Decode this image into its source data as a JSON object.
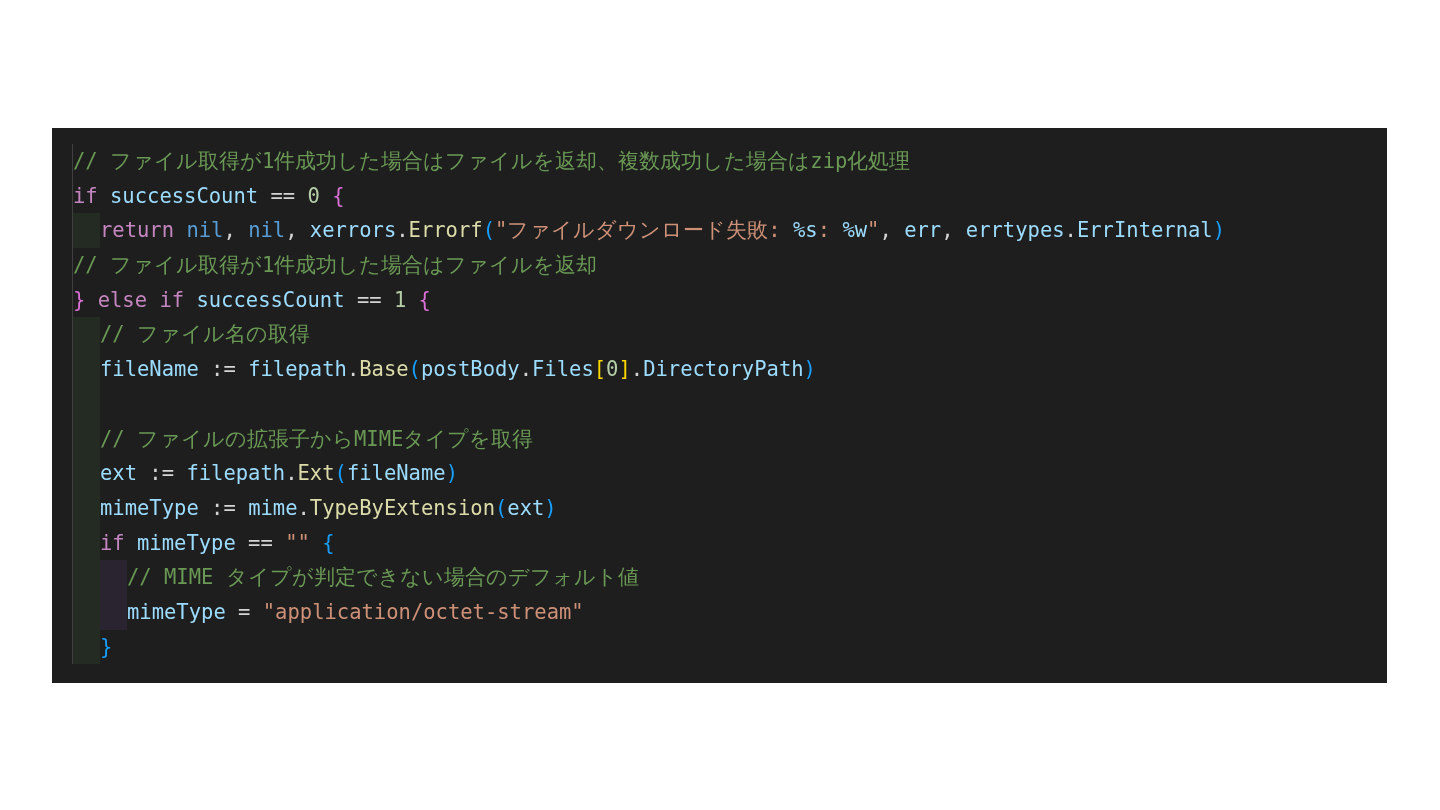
{
  "editor": {
    "lines": [
      {
        "tokens": [
          {
            "text": "// ファイル取得が1件成功した場合はファイルを返却、複数成功した場合はzip化処理",
            "kind": "comment"
          }
        ]
      },
      {
        "tokens": [
          {
            "text": "if ",
            "kind": "keyword"
          },
          {
            "text": "successCount",
            "kind": "variable"
          },
          {
            "text": " == ",
            "kind": "plain"
          },
          {
            "text": "0 ",
            "kind": "number"
          },
          {
            "text": "{",
            "kind": "brace"
          }
        ],
        "children": [
          {
            "tokens": [
              {
                "text": "return ",
                "kind": "keyword"
              },
              {
                "text": "nil",
                "kind": "constant"
              },
              {
                "text": ", ",
                "kind": "plain"
              },
              {
                "text": "nil",
                "kind": "constant"
              },
              {
                "text": ", ",
                "kind": "plain"
              },
              {
                "text": "xerrors",
                "kind": "variable"
              },
              {
                "text": ".",
                "kind": "plain"
              },
              {
                "text": "Errorf",
                "kind": "function"
              },
              {
                "text": "(",
                "kind": "paren"
              },
              {
                "text": "\"ファイルダウンロード失敗: ",
                "kind": "string"
              },
              {
                "text": "%s",
                "kind": "variable"
              },
              {
                "text": ": ",
                "kind": "string"
              },
              {
                "text": "%w",
                "kind": "variable"
              },
              {
                "text": "\"",
                "kind": "string"
              },
              {
                "text": ", ",
                "kind": "plain"
              },
              {
                "text": "err",
                "kind": "variable"
              },
              {
                "text": ", ",
                "kind": "plain"
              },
              {
                "text": "errtypes",
                "kind": "variable"
              },
              {
                "text": ".",
                "kind": "plain"
              },
              {
                "text": "ErrInternal",
                "kind": "variable"
              },
              {
                "text": ")",
                "kind": "paren"
              }
            ]
          }
        ]
      },
      {
        "tokens": [
          {
            "text": "// ファイル取得が1件成功した場合はファイルを返却",
            "kind": "comment"
          }
        ]
      },
      {
        "tokens": [
          {
            "text": "} ",
            "kind": "brace"
          },
          {
            "text": "else if ",
            "kind": "keyword"
          },
          {
            "text": "successCount",
            "kind": "variable"
          },
          {
            "text": " == ",
            "kind": "plain"
          },
          {
            "text": "1 ",
            "kind": "number"
          },
          {
            "text": "{",
            "kind": "brace"
          }
        ],
        "children": [
          {
            "tokens": [
              {
                "text": "// ファイル名の取得",
                "kind": "comment"
              }
            ]
          },
          {
            "tokens": [
              {
                "text": "fileName",
                "kind": "variable"
              },
              {
                "text": " := ",
                "kind": "plain"
              },
              {
                "text": "filepath",
                "kind": "variable"
              },
              {
                "text": ".",
                "kind": "plain"
              },
              {
                "text": "Base",
                "kind": "function"
              },
              {
                "text": "(",
                "kind": "paren"
              },
              {
                "text": "postBody",
                "kind": "variable"
              },
              {
                "text": ".",
                "kind": "plain"
              },
              {
                "text": "Files",
                "kind": "variable"
              },
              {
                "text": "[",
                "kind": "bracket"
              },
              {
                "text": "0",
                "kind": "number"
              },
              {
                "text": "]",
                "kind": "bracket"
              },
              {
                "text": ".",
                "kind": "plain"
              },
              {
                "text": "DirectoryPath",
                "kind": "variable"
              },
              {
                "text": ")",
                "kind": "paren"
              }
            ]
          },
          {
            "kind": "blank"
          },
          {
            "tokens": [
              {
                "text": "// ファイルの拡張子からMIMEタイプを取得",
                "kind": "comment"
              }
            ]
          },
          {
            "tokens": [
              {
                "text": "ext",
                "kind": "variable"
              },
              {
                "text": " := ",
                "kind": "plain"
              },
              {
                "text": "filepath",
                "kind": "variable"
              },
              {
                "text": ".",
                "kind": "plain"
              },
              {
                "text": "Ext",
                "kind": "function"
              },
              {
                "text": "(",
                "kind": "paren"
              },
              {
                "text": "fileName",
                "kind": "variable"
              },
              {
                "text": ")",
                "kind": "paren"
              }
            ]
          },
          {
            "tokens": [
              {
                "text": "mimeType",
                "kind": "variable"
              },
              {
                "text": " := ",
                "kind": "plain"
              },
              {
                "text": "mime",
                "kind": "variable"
              },
              {
                "text": ".",
                "kind": "plain"
              },
              {
                "text": "TypeByExtension",
                "kind": "function"
              },
              {
                "text": "(",
                "kind": "paren"
              },
              {
                "text": "ext",
                "kind": "variable"
              },
              {
                "text": ")",
                "kind": "paren"
              }
            ]
          },
          {
            "tokens": [
              {
                "text": "if ",
                "kind": "keyword"
              },
              {
                "text": "mimeType",
                "kind": "variable"
              },
              {
                "text": " == ",
                "kind": "plain"
              },
              {
                "text": "\"\" ",
                "kind": "string"
              },
              {
                "text": "{",
                "kind": "paren"
              }
            ],
            "children": [
              {
                "tokens": [
                  {
                    "text": "// MIME タイプが判定できない場合のデフォルト値",
                    "kind": "comment"
                  }
                ]
              },
              {
                "tokens": [
                  {
                    "text": "mimeType",
                    "kind": "variable"
                  },
                  {
                    "text": " = ",
                    "kind": "plain"
                  },
                  {
                    "text": "\"application/octet-stream\"",
                    "kind": "string"
                  }
                ]
              }
            ]
          },
          {
            "tokens": [
              {
                "text": "}",
                "kind": "paren"
              }
            ]
          }
        ]
      }
    ]
  }
}
